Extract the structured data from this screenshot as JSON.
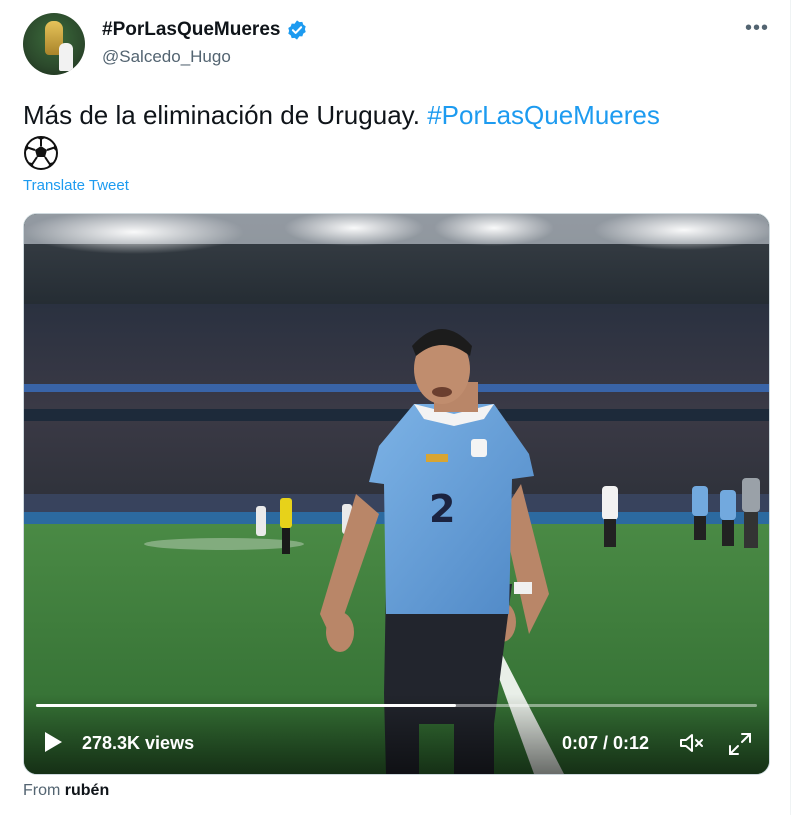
{
  "author": {
    "display_name": "#PorLasQueMueres",
    "handle": "@Salcedo_Hugo",
    "verified": true
  },
  "tweet": {
    "text_prefix": "Más de la eliminación de Uruguay.",
    "hashtag": "#PorLasQueMueres",
    "emoji_icon": "soccer-ball-icon",
    "translate_label": "Translate Tweet"
  },
  "video": {
    "views": "278.3K views",
    "current_time": "0:07",
    "duration": "0:12",
    "time_display": "0:07 / 0:12",
    "progress": 0.583,
    "jersey_number": "2"
  },
  "footer": {
    "from_label": "From",
    "from_name": "rubén"
  },
  "colors": {
    "accent": "#1d9bf0",
    "text": "#0f1419",
    "secondary": "#536471",
    "jersey": "#6fa6dc",
    "pitch": "#3f7a3c"
  }
}
